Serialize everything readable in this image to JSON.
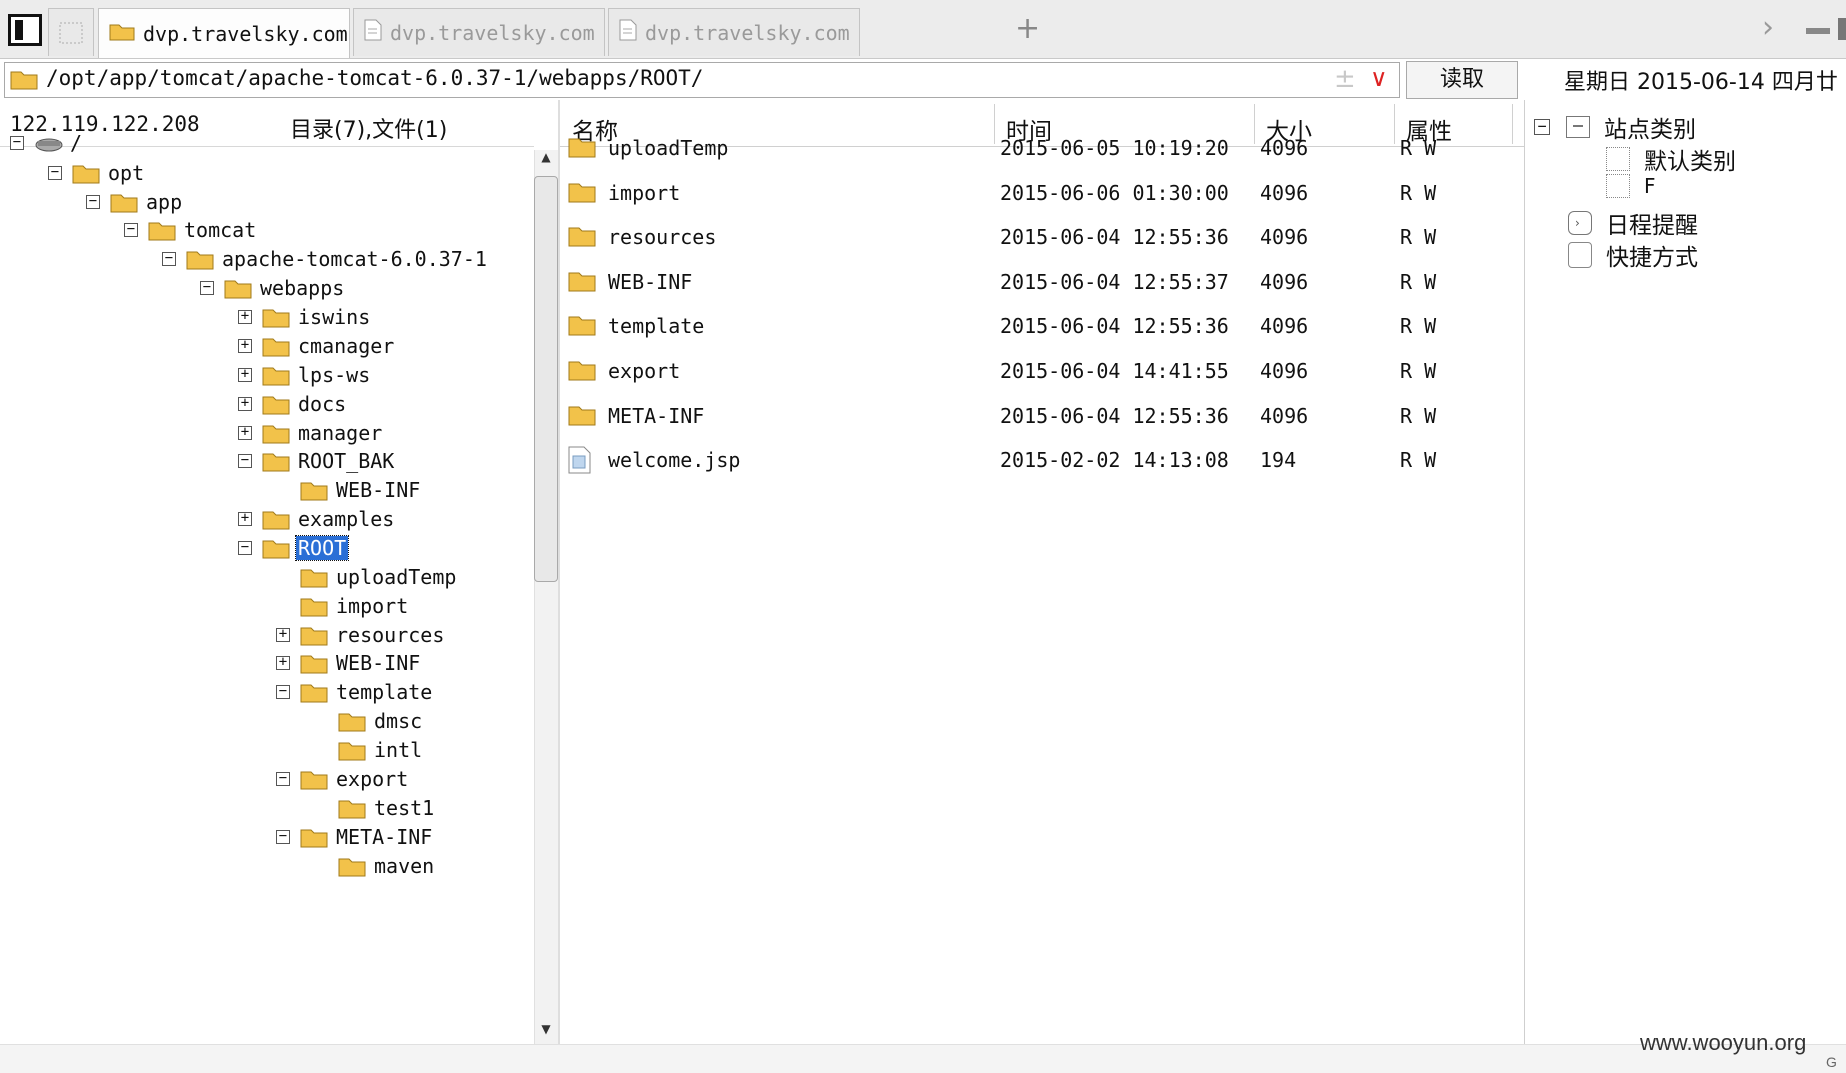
{
  "tabs": [
    {
      "label": "dvp.travelsky.com",
      "active": true
    },
    {
      "label": "dvp.travelsky.com",
      "active": false
    },
    {
      "label": "dvp.travelsky.com",
      "active": false
    }
  ],
  "address": {
    "path": "/opt/app/tomcat/apache-tomcat-6.0.37-1/webapps/ROOT/",
    "read_label": "读取"
  },
  "date_text": "星期日 2015-06-14 四月廿",
  "server_ip": "122.119.122.208",
  "dir_summary": "目录(7),文件(1)",
  "tree": [
    {
      "label": "/",
      "type": "drive",
      "expanded": true
    },
    {
      "label": "opt",
      "expanded": true
    },
    {
      "label": "app",
      "expanded": true
    },
    {
      "label": "tomcat",
      "expanded": true
    },
    {
      "label": "apache-tomcat-6.0.37-1",
      "expanded": true
    },
    {
      "label": "webapps",
      "expanded": true
    },
    {
      "label": "iswins",
      "expanded": false
    },
    {
      "label": "cmanager",
      "expanded": false
    },
    {
      "label": "lps-ws",
      "expanded": false
    },
    {
      "label": "docs",
      "expanded": false
    },
    {
      "label": "manager",
      "expanded": false
    },
    {
      "label": "ROOT_BAK",
      "expanded": true
    },
    {
      "label": "WEB-INF"
    },
    {
      "label": "examples",
      "expanded": false
    },
    {
      "label": "ROOT",
      "expanded": true,
      "selected": true
    },
    {
      "label": "uploadTemp"
    },
    {
      "label": "import"
    },
    {
      "label": "resources",
      "expanded": false
    },
    {
      "label": "WEB-INF",
      "expanded": false
    },
    {
      "label": "template",
      "expanded": true
    },
    {
      "label": "dmsc"
    },
    {
      "label": "intl"
    },
    {
      "label": "export",
      "expanded": true
    },
    {
      "label": "test1"
    },
    {
      "label": "META-INF",
      "expanded": true
    },
    {
      "label": "maven"
    }
  ],
  "columns": {
    "name": "名称",
    "time": "时间",
    "size": "大小",
    "attr": "属性"
  },
  "files": [
    {
      "name": "uploadTemp",
      "time": "2015-06-05 10:19:20",
      "size": "4096",
      "attr": "R W",
      "type": "folder"
    },
    {
      "name": "import",
      "time": "2015-06-06 01:30:00",
      "size": "4096",
      "attr": "R W",
      "type": "folder"
    },
    {
      "name": "resources",
      "time": "2015-06-04 12:55:36",
      "size": "4096",
      "attr": "R W",
      "type": "folder"
    },
    {
      "name": "WEB-INF",
      "time": "2015-06-04 12:55:37",
      "size": "4096",
      "attr": "R W",
      "type": "folder"
    },
    {
      "name": "template",
      "time": "2015-06-04 12:55:36",
      "size": "4096",
      "attr": "R W",
      "type": "folder"
    },
    {
      "name": "export",
      "time": "2015-06-04 14:41:55",
      "size": "4096",
      "attr": "R W",
      "type": "folder"
    },
    {
      "name": "META-INF",
      "time": "2015-06-04 12:55:36",
      "size": "4096",
      "attr": "R W",
      "type": "folder"
    },
    {
      "name": "welcome.jsp",
      "time": "2015-02-02 14:13:08",
      "size": "194",
      "attr": "R W",
      "type": "file"
    }
  ],
  "right_tree": {
    "root": "站点类别",
    "children": [
      "默认类别",
      "F"
    ],
    "schedule": "日程提醒",
    "shortcut": "快捷方式"
  },
  "watermark": "www.wooyun.org",
  "watermark_corner": "G",
  "colors": {
    "selection": "#2a6fd6",
    "folder": "#f2c24a",
    "addr_arrow": "#dd2222"
  }
}
